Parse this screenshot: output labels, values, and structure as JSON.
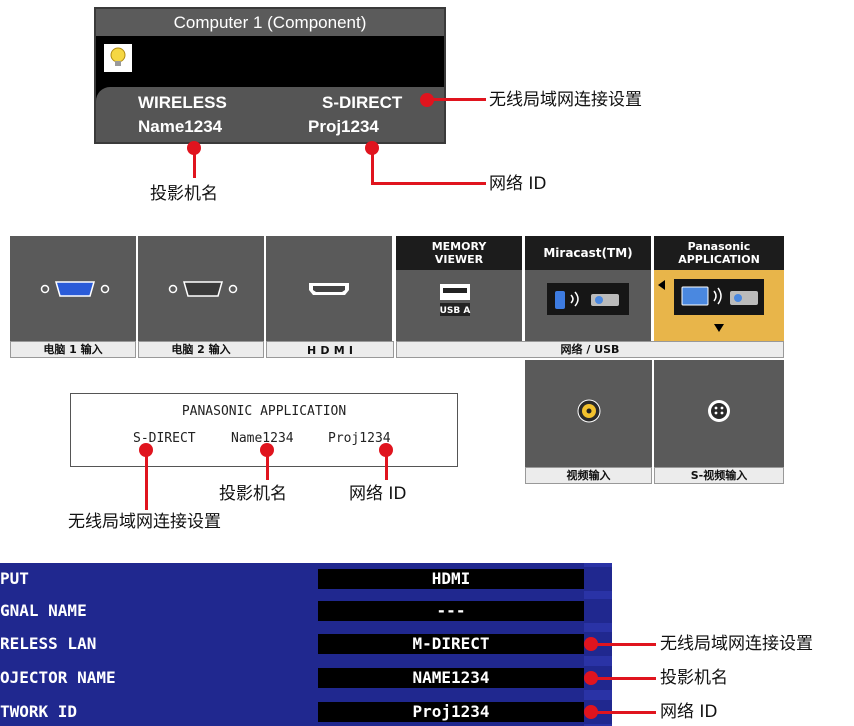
{
  "panel1": {
    "title": "Computer 1 (Component)",
    "mode": "WIRELESS",
    "connection": "S-DIRECT",
    "name": "Name1234",
    "network_id": "Proj1234"
  },
  "callouts": {
    "wireless_setting": "无线局域网连接设置",
    "projector_name": "投影机名",
    "network_id": "网络 ID"
  },
  "inputs": {
    "tiles": [
      {
        "head": "",
        "label": "电脑 1 输入"
      },
      {
        "head": "",
        "label": "电脑 2 输入"
      },
      {
        "head": "",
        "label": "HDMI"
      },
      {
        "head": "MEMORY VIEWER",
        "sub": "USB A"
      },
      {
        "head": "Miracast(TM)"
      },
      {
        "head": "Panasonic APPLICATION"
      }
    ],
    "network_usb_label": "网络 / USB",
    "video_label": "视频输入",
    "svideo_label": "S-视频输入"
  },
  "panel2": {
    "title": "PANASONIC APPLICATION",
    "connection": "S-DIRECT",
    "name": "Name1234",
    "network_id": "Proj1234"
  },
  "panel3": {
    "rows": [
      {
        "label": "PUT",
        "value": "HDMI"
      },
      {
        "label": "GNAL NAME",
        "value": "---"
      },
      {
        "label": "RELESS LAN",
        "value": "M-DIRECT"
      },
      {
        "label": "OJECTOR NAME",
        "value": "NAME1234"
      },
      {
        "label": "TWORK ID",
        "value": "Proj1234"
      }
    ]
  },
  "colors": {
    "accent_red": "#e0141e",
    "menu_blue": "#20288f",
    "highlight_yellow": "#e8b54a"
  }
}
